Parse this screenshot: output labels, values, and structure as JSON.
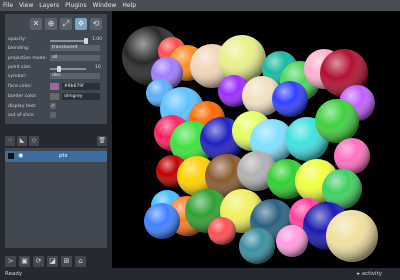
{
  "menu": [
    "File",
    "View",
    "Layers",
    "Plugins",
    "Window",
    "Help"
  ],
  "controls": {
    "opacity_label": "opacity:",
    "opacity_value": "1.00",
    "blending_label": "blending:",
    "blending_value": "translucent",
    "projection_label": "projection mode:",
    "projection_value": "all",
    "point_size_label": "point size:",
    "point_size_value": "10",
    "symbol_label": "symbol:",
    "symbol_value": "disc",
    "face_color_label": "face color:",
    "face_color_hex": "#9b679f",
    "face_color": "#9b679f",
    "border_color_label": "border color:",
    "border_color_name": "dimgrey",
    "border_color": "#696969",
    "display_text_label": "display text:",
    "out_of_slice_label": "out of slice:"
  },
  "layers": {
    "name": "pts"
  },
  "status": {
    "left": "Ready",
    "right": "▸ activity"
  }
}
